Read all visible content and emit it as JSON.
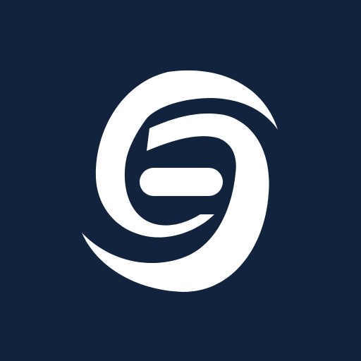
{
  "icon": {
    "name": "swirl-logo-icon",
    "background_color": "#12233d",
    "foreground_color": "#ffffff"
  }
}
